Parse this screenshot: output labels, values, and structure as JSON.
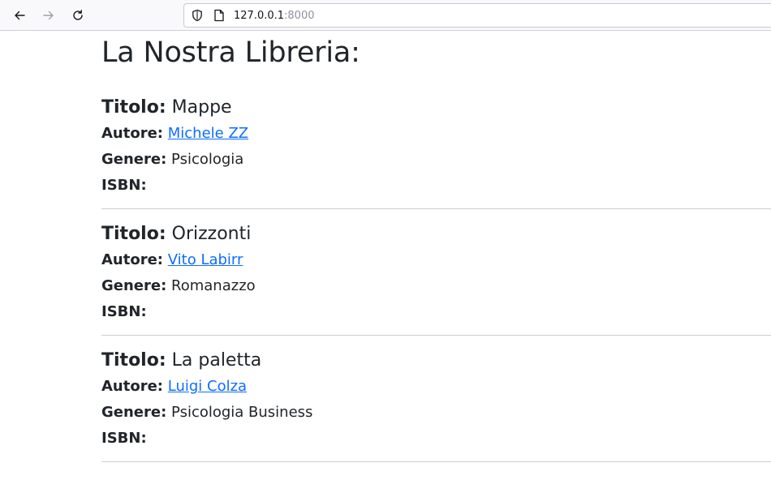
{
  "browser": {
    "url_host": "127.0.0.1",
    "url_port": ":8000"
  },
  "page": {
    "title": "La Nostra Libreria:"
  },
  "labels": {
    "titolo": "Titolo:",
    "autore": "Autore:",
    "genere": "Genere:",
    "isbn": "ISBN:"
  },
  "books": [
    {
      "title": "Mappe",
      "author": "Michele ZZ",
      "genre": "Psicologia",
      "isbn": ""
    },
    {
      "title": "Orizzonti",
      "author": "Vito Labirr",
      "genre": "Romanazzo",
      "isbn": ""
    },
    {
      "title": "La paletta",
      "author": "Luigi Colza",
      "genre": "Psicologia Business",
      "isbn": ""
    }
  ],
  "colors": {
    "link": "#0d6efd",
    "text": "#212529",
    "divider": "#cdcdcd"
  }
}
